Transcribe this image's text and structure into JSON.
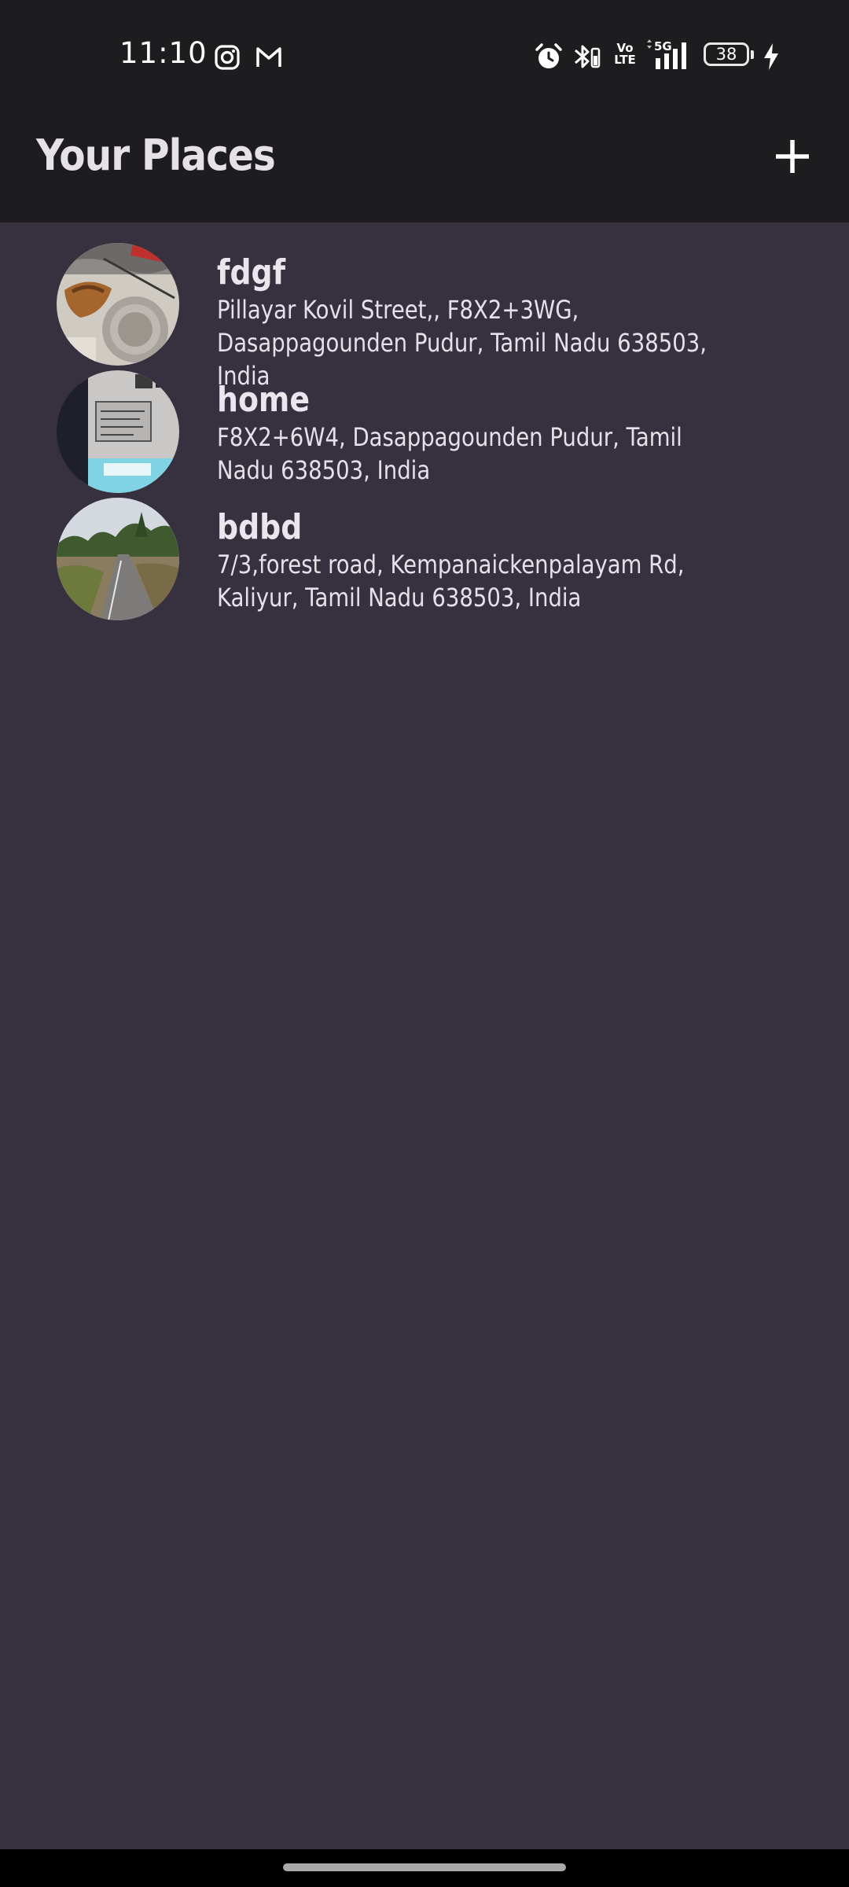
{
  "status_bar": {
    "time": "11:10",
    "battery_level": "38",
    "network": "5G",
    "volte": "Vo LTE"
  },
  "app_bar": {
    "title": "Your Places",
    "add_icon": "plus-icon"
  },
  "places": [
    {
      "title": "fdgf",
      "address": "Pillayar Kovil Street,, F8X2+3WG, Dasappagounden Pudur, Tamil Nadu 638503, India"
    },
    {
      "title": "home",
      "address": "F8X2+6W4, Dasappagounden Pudur, Tamil Nadu 638503, India"
    },
    {
      "title": "bdbd",
      "address": "7/3,forest road, Kempanaickenpalayam Rd, Kaliyur, Tamil Nadu 638503, India"
    }
  ],
  "colors": {
    "background": "#37313f",
    "app_bar": "#1d1c1f",
    "text": "#e6e1e8"
  }
}
